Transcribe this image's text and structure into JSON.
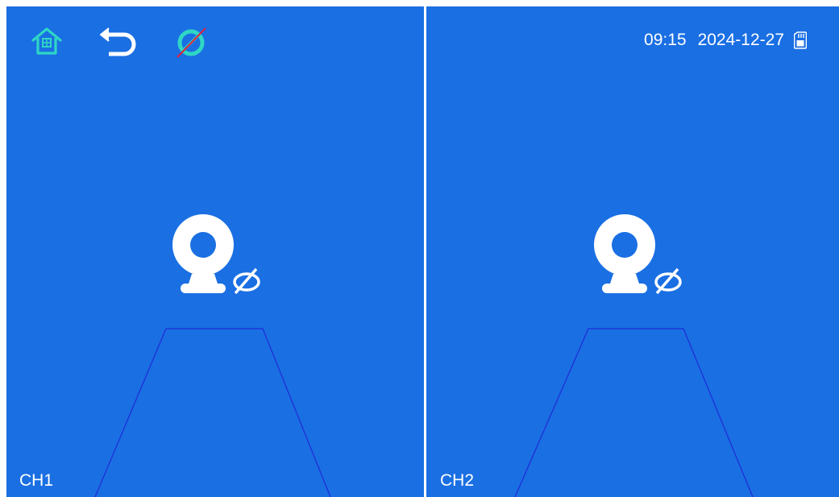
{
  "toolbar": {
    "home_icon": "home-icon",
    "back_icon": "back-arrow-icon",
    "signal_icon": "no-signal-icon"
  },
  "status_bar": {
    "time": "09:15",
    "date": "2024-12-27",
    "storage_icon": "sd-card-icon"
  },
  "channels": [
    {
      "label": "CH1",
      "state_icon": "camera-disconnected-icon"
    },
    {
      "label": "CH2",
      "state_icon": "camera-disconnected-icon"
    }
  ],
  "colors": {
    "background": "#1a6fe3",
    "accent": "#2fd6c4",
    "divider": "#ffffff",
    "guide_line": "#1f2fd8",
    "no_signal_slash": "#e0203a"
  }
}
